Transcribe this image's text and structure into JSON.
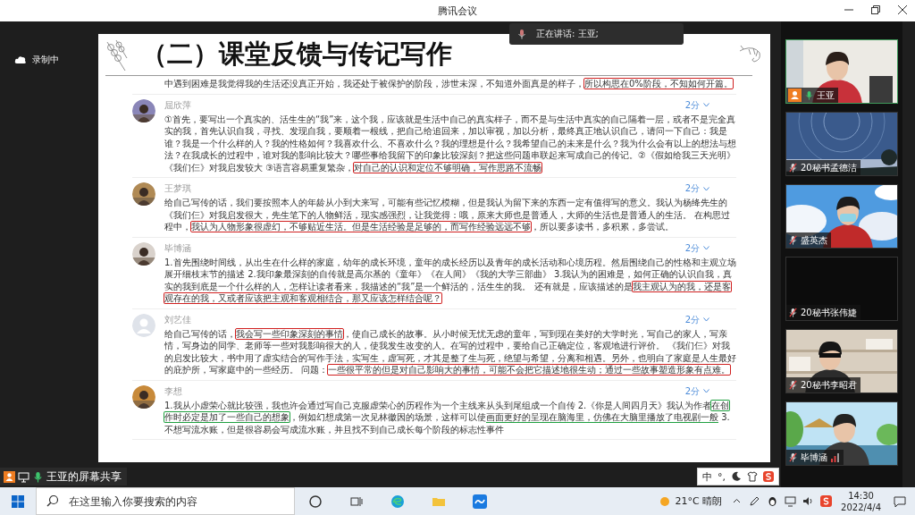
{
  "window": {
    "title": "腾讯会议"
  },
  "recording": {
    "label": "录制中"
  },
  "speaking_banner": {
    "text": "正在讲话: 王亚;"
  },
  "slide": {
    "title": "（二）课堂反馈与传记写作",
    "cut_comment": {
      "segments": [
        {
          "kind": "plain",
          "text": "中遇到困难是我觉得我的生活还没真正开始，我还处于被保护的阶段，涉世未深，不知道外面真是的样子，"
        },
        {
          "kind": "red-box",
          "text": "所以构思在0%阶段，不知如何开篇。"
        }
      ]
    },
    "comments": [
      {
        "name": "屈欣萍",
        "has_photo": true,
        "score": "2分",
        "segments": [
          {
            "kind": "plain",
            "text": "①首先，要写出一个真实的、活生生的“我”来，这个我，应该就是生活中自己的真实样子，而不是与生活中真实的自己隔着一层，或者不是完全真实的我，首先认识自我，寻找、发现自我，要顺着一根线，把自己给追回来，加以审视，加以分析，最终真正地认识自己，请问一下自己：我是谁？我是一个什么样的人？我的性格如何？我喜欢什么、不喜欢什么？我的理想是什么？我希望自己的未来是什么？我为什么会有以上的想法与想法？在我成长的过程中，谁对我的影响比较大？哪些事给我留下的印象比较深刻？把这些问题串联起来写成自己的传记。②《假如给我三天光明》《我们仨》对我启发较大 ③语言容易重复繁杂，"
          },
          {
            "kind": "red-box",
            "text": "对自己的认识和定位不够明确，写作思路不流畅"
          }
        ]
      },
      {
        "name": "王梦琪",
        "has_photo": true,
        "score": "2分",
        "segments": [
          {
            "kind": "plain",
            "text": "给自己写传的话，我们要按照本人的年龄从小到大来写，可能有些记忆模糊，但是我认为留下来的东西一定有值得写的意义。我认为杨绛先生的《我们仨》对我启发很大，先生笔下的人物鲜活，现实感强烈，让我觉得：哦，原来大师也是普通人，大师的生活也是普通人的生活。 在构思过程中，"
          },
          {
            "kind": "red-box",
            "text": "我认为人物形象很虚幻，不够贴近生活。但是生活经验是足够的，而写作经验远远不够"
          },
          {
            "kind": "plain",
            "text": "，所以要多读书，多积累，多尝试。"
          }
        ]
      },
      {
        "name": "毕博涵",
        "has_photo": true,
        "score": "2分",
        "segments": [
          {
            "kind": "plain",
            "text": "1.首先围绕时间线，从出生在什么样的家庭，幼年的成长环境，童年的成长经历以及青年的成长活动和心境历程。然后围绕自己的性格和主观立场展开细枝末节的描述 2.我印象最深刻的自传就是高尔基的《童年》《在人间》《我的大学三部曲》 3.我认为的困难是，如何正确的认识自我，真实的我到底是一个什么样的人，怎样让读者看来，我描述的“我”是一个鲜活的，活生生的我。 还有就是，应该描述的是"
          },
          {
            "kind": "red-box",
            "text": "我主观认为的我，还是客观存在的我，又或者应该把主观和客观相结合，那又应该怎样结合呢？"
          }
        ]
      },
      {
        "name": "刘艺佳",
        "has_photo": false,
        "score": "2分",
        "segments": [
          {
            "kind": "plain",
            "text": "给自己写传的话，"
          },
          {
            "kind": "red-box",
            "text": "我会写一些印象深刻的事情"
          },
          {
            "kind": "plain",
            "text": "，使自己成长的故事。从小时候无忧无虑的童年，写到现在美好的大学时光，写自己的家人，写亲情，写身边的同学、老师等一些对我影响很大的人，使我发生改变的人。在写的过程中，要给自己正确定位，客观地进行评价。 《我们仨》对我的启发比较大，书中用了虚实结合的写作手法，实写生，虚写死，才其是整了生与死，绝望与希望，分离和相遇。另外，也明白了家庭是人生最好的庇护所，写家庭中的一些经历。 问题："
          },
          {
            "kind": "red-box",
            "text": "一些很平常的但是对自己影响大的事情，可能不会把它描述地很生动；通过一些故事塑造形象有点难。"
          }
        ]
      },
      {
        "name": "李想",
        "has_photo": true,
        "score": "2分",
        "segments": [
          {
            "kind": "plain",
            "text": "1.我从小虚荣心就比较强，我也许会通过写自己克服虚荣心的历程作为一个主线来从头到尾组成一个自传 2.《你是人间四月天》我认为作者"
          },
          {
            "kind": "green-box",
            "text": "在创作时必定是加了一些自己的想象"
          },
          {
            "kind": "plain",
            "text": "，例如幻想成第一次见林徽因的场景，这样可以使"
          },
          {
            "kind": "green-underline",
            "text": "画面更好的呈现在脑海里，仿佛在大脑里播放了电视剧一般"
          },
          {
            "kind": "plain",
            "text": " 3.不想写流水账，但是很容易会写成流水账，并且找不到自己成长每个阶段的标志性事件"
          }
        ]
      }
    ]
  },
  "share_label": {
    "text": "王亚的屏幕共享"
  },
  "ime_bar": {
    "mode": "中",
    "punct": "°,"
  },
  "participants": [
    {
      "name": "王亚",
      "speaking": true,
      "video": true,
      "weak_network": false
    },
    {
      "name": "20秘书孟德洁",
      "speaking": false,
      "video": true,
      "weak_network": false
    },
    {
      "name": "盛英杰",
      "speaking": false,
      "video": true,
      "weak_network": false
    },
    {
      "name": "20秘书张伟婕",
      "speaking": false,
      "video": false,
      "weak_network": false
    },
    {
      "name": "20秘书李昭君",
      "speaking": false,
      "video": true,
      "weak_network": false
    },
    {
      "name": "毕博涵",
      "speaking": false,
      "video": true,
      "weak_network": true
    }
  ],
  "taskbar": {
    "search": {
      "placeholder": "在这里输入你要搜索的内容"
    },
    "weather": "21°C 晴朗",
    "time": "14:30",
    "date": "2022/4/4"
  }
}
